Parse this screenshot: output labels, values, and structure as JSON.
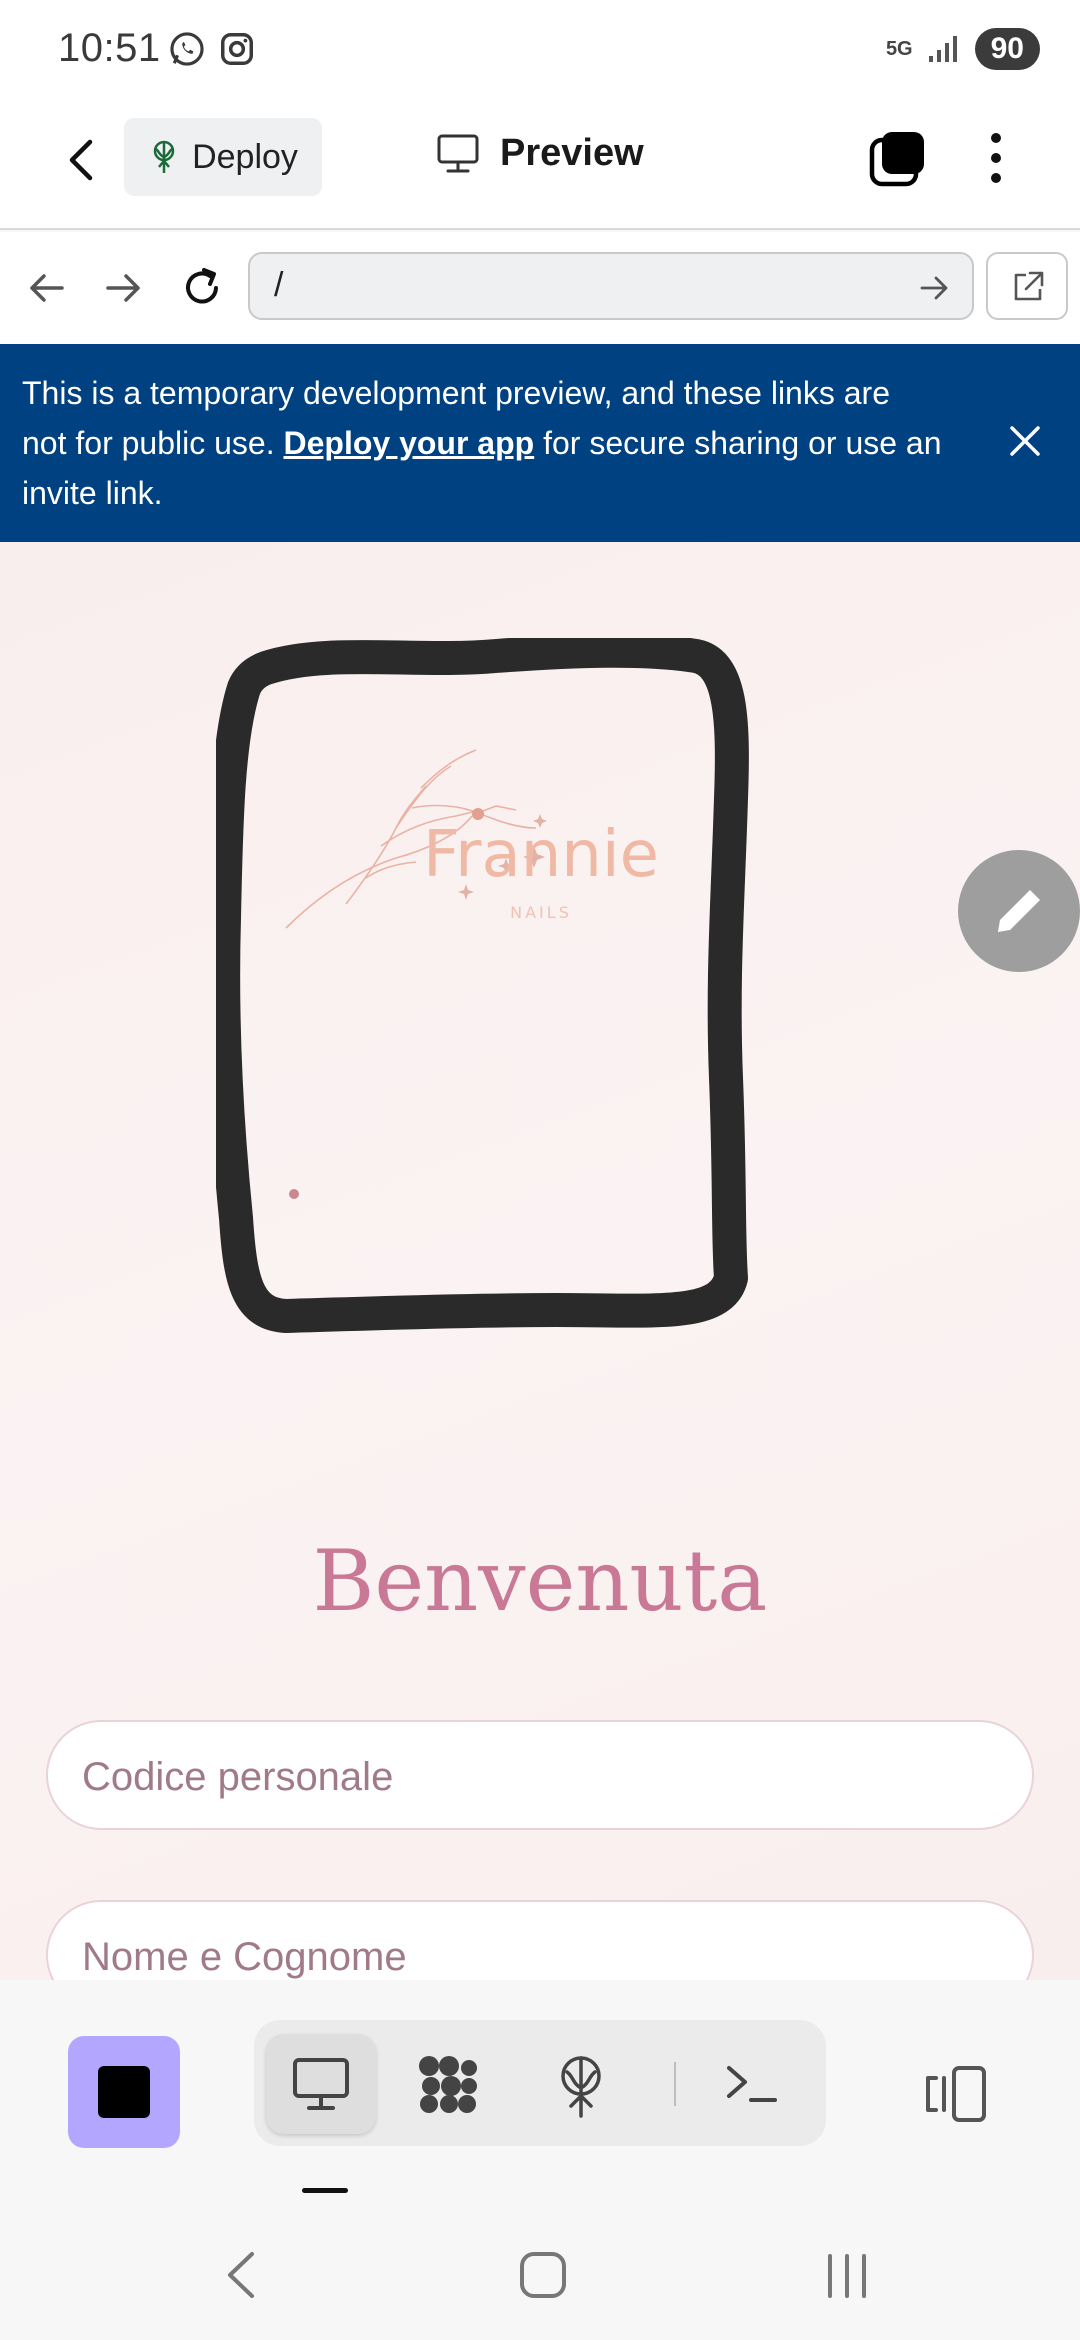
{
  "status_bar": {
    "time": "10:51",
    "network": "5G",
    "battery": "90",
    "icons": [
      "whatsapp-icon",
      "instagram-icon",
      "signal-icon"
    ]
  },
  "app_bar": {
    "deploy_label": "Deploy",
    "title": "Preview"
  },
  "url_bar": {
    "url": "/"
  },
  "banner": {
    "text_before": "This is a temporary development preview, and these links are not for public use. ",
    "link_text": "Deploy your app",
    "text_after": " for secure sharing or use an invite link.",
    "color": "#004182"
  },
  "logo": {
    "name": "Frannie",
    "tagline": "NAILS"
  },
  "main": {
    "heading": "Benvenuta",
    "code_placeholder": "Codice personale",
    "name_placeholder": "Nome e Cognome",
    "accent_color": "#c97895"
  },
  "toolbar": {
    "stop_color": "#b3a6ff",
    "tabs": [
      "preview-icon",
      "workspace-icon",
      "deploy-icon",
      "console-icon"
    ],
    "active_tab": "preview-icon"
  }
}
